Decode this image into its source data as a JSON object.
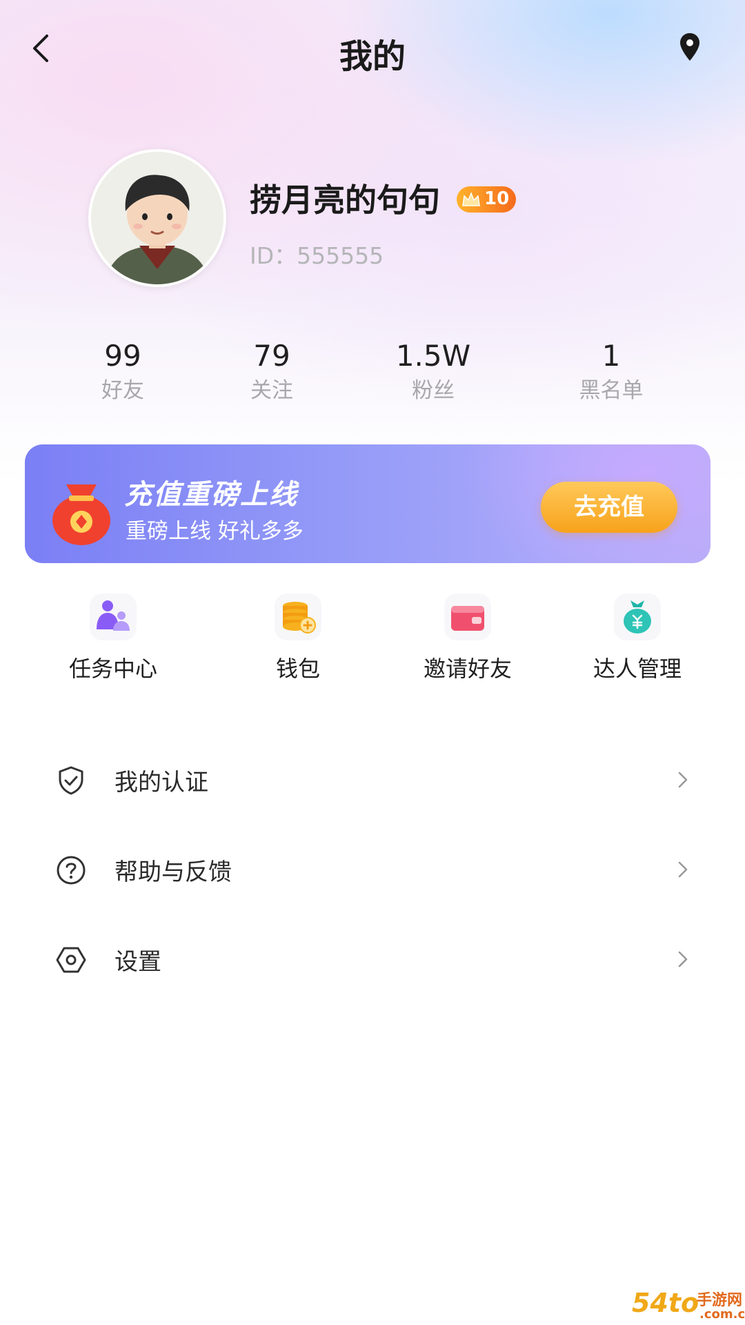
{
  "header": {
    "title": "我的"
  },
  "profile": {
    "username": "捞月亮的句句",
    "level": "10",
    "id_text": "ID：555555"
  },
  "stats": [
    {
      "value": "99",
      "label": "好友"
    },
    {
      "value": "79",
      "label": "关注"
    },
    {
      "value": "1.5W",
      "label": "粉丝"
    },
    {
      "value": "1",
      "label": "黑名单"
    }
  ],
  "banner": {
    "title": "充值重磅上线",
    "subtitle": "重磅上线 好礼多多",
    "button": "去充值"
  },
  "quick_actions": [
    {
      "label": "任务中心",
      "icon": "task-center-icon"
    },
    {
      "label": "钱包",
      "icon": "wallet-coins-icon"
    },
    {
      "label": "邀请好友",
      "icon": "invite-wallet-icon"
    },
    {
      "label": "达人管理",
      "icon": "money-bag-icon"
    }
  ],
  "menu": [
    {
      "label": "我的认证",
      "icon": "shield-check-icon"
    },
    {
      "label": "帮助与反馈",
      "icon": "help-circle-icon"
    },
    {
      "label": "设置",
      "icon": "settings-hexagon-icon"
    }
  ],
  "watermark": {
    "logo": "54to",
    "text1": "手游网",
    "text2": ".com.cn"
  },
  "colors": {
    "banner_start": "#7b7ff5",
    "banner_end": "#b7aef7",
    "recharge_button": "#f7a21b",
    "level_badge": "#f56a1c"
  }
}
